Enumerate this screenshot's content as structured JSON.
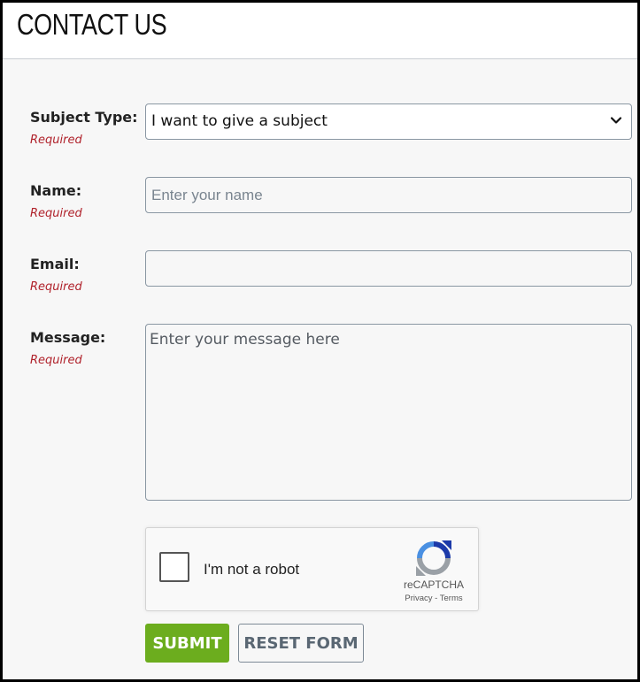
{
  "page": {
    "title": "CONTACT US"
  },
  "form": {
    "subject_type": {
      "label": "Subject Type:",
      "required": "Required",
      "selected": "I want to give a subject"
    },
    "name": {
      "label": "Name:",
      "required": "Required",
      "placeholder": "Enter your name",
      "value": ""
    },
    "email": {
      "label": "Email:",
      "required": "Required",
      "placeholder": "",
      "value": ""
    },
    "message": {
      "label": "Message:",
      "required": "Required",
      "placeholder": "Enter your message here",
      "value": ""
    }
  },
  "recaptcha": {
    "checkbox_label": "I'm not a robot",
    "brand": "reCAPTCHA",
    "links": "Privacy - Terms",
    "checked": false
  },
  "buttons": {
    "submit": "SUBMIT",
    "reset": "RESET FORM"
  },
  "colors": {
    "accent": "#6cad1e",
    "required": "#b0222b",
    "border": "#8a97a3"
  }
}
